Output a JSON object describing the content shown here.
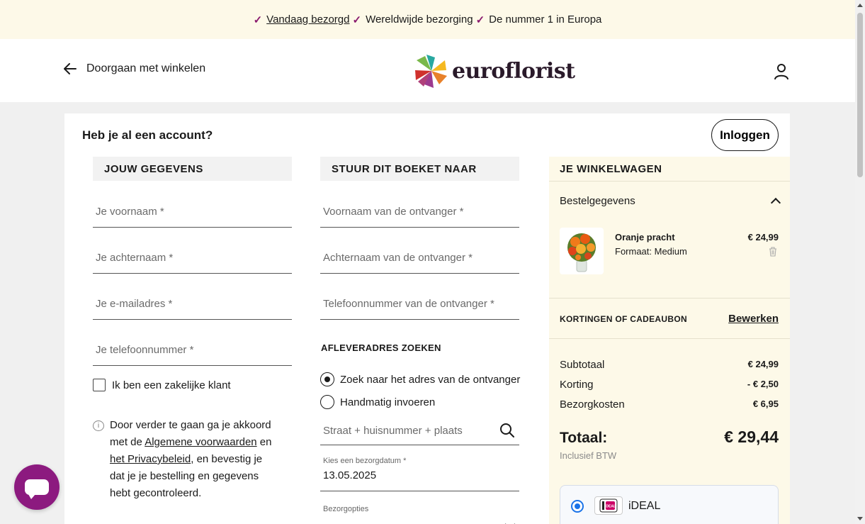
{
  "topbar": {
    "item1": "Vandaag bezorgd",
    "item2": "Wereldwijde bezorging",
    "item3": "De nummer 1 in Europa"
  },
  "header": {
    "back_label": "Doorgaan met winkelen",
    "logo_text": "euroflorist"
  },
  "account": {
    "question": "Heb je al een account?",
    "login_label": "Inloggen"
  },
  "your_details": {
    "heading": "JOUW GEGEVENS",
    "first_name_placeholder": "Je voornaam *",
    "last_name_placeholder": "Je achternaam *",
    "email_placeholder": "Je e-mailadres *",
    "phone_placeholder": "Je telefoonnummer *",
    "business_label": "Ik ben een zakelijke klant",
    "terms_part1": "Door verder te gaan ga je akkoord met de ",
    "terms_link1": "Algemene voorwaarden",
    "terms_part2": " en ",
    "terms_link2": "het Privacybeleid",
    "terms_part3": ", en bevestig je dat je je bestelling en gegevens hebt gecontroleerd."
  },
  "recipient": {
    "heading": "STUUR DIT BOEKET NAAR",
    "first_name_placeholder": "Voornaam van de ontvanger *",
    "last_name_placeholder": "Achternaam van de ontvanger *",
    "phone_placeholder": "Telefoonnummer van de ontvanger *",
    "address_heading": "AFLEVERADRES ZOEKEN",
    "radio_search": "Zoek naar het adres van de ontvanger",
    "radio_manual": "Handmatig invoeren",
    "address_placeholder": "Straat + huisnummer + plaats",
    "date_label": "Kies een bezorgdatum *",
    "date_value": "13.05.2025",
    "options_label": "Bezorgopties"
  },
  "cart": {
    "heading": "JE WINKELWAGEN",
    "order_details": "Bestelgegevens",
    "product_name": "Oranje pracht",
    "product_size": "Formaat: Medium",
    "product_price": "€ 24,99",
    "discount_label": "KORTINGEN OF CADEAUBON",
    "discount_edit": "Bewerken",
    "subtotal_label": "Subtotaal",
    "subtotal_value": "€ 24,99",
    "discount_row_label": "Korting",
    "discount_row_value": "- € 2,50",
    "shipping_label": "Bezorgkosten",
    "shipping_value": "€ 6,95",
    "total_label": "Totaal:",
    "total_value": "€ 29,44",
    "vat_note": "Inclusief BTW",
    "payment_method": "iDEAL",
    "ideal_logo_text": "iDEAL"
  },
  "colors": {
    "accent": "#8a1b6e",
    "chat_button": "#8c1a7f",
    "topbar_bg": "#fdf9e8",
    "payment_radio": "#1a73e8"
  }
}
